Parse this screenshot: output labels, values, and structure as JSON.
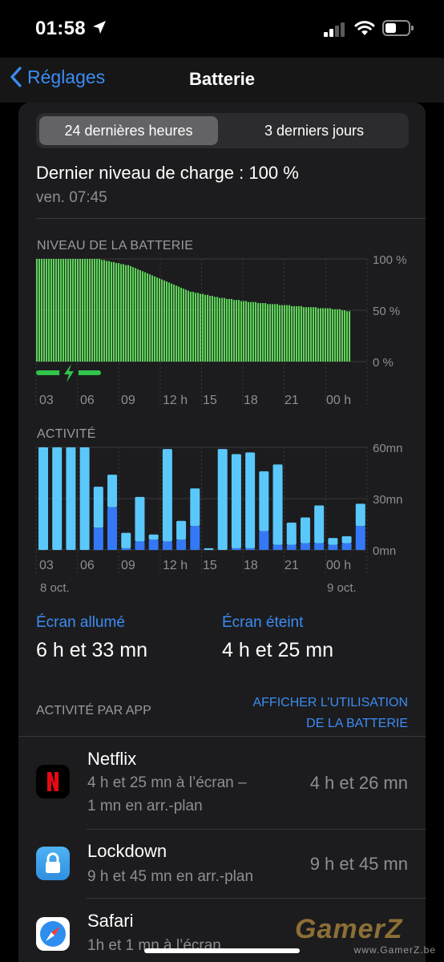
{
  "status": {
    "time": "01:58"
  },
  "nav": {
    "back_label": "Réglages",
    "title": "Batterie"
  },
  "segments": [
    "24 dernières heures",
    "3 derniers jours"
  ],
  "last_charge": {
    "label": "Dernier niveau de charge : 100 %",
    "date": "ven. 07:45"
  },
  "battery_chart": {
    "title": "NIVEAU DE LA BATTERIE",
    "y_ticks": [
      "100 %",
      "50 %",
      "0 %"
    ],
    "x_ticks": [
      "03",
      "06",
      "09",
      "12 h",
      "15",
      "18",
      "21",
      "00 h"
    ]
  },
  "activity_chart": {
    "title": "ACTIVITÉ",
    "y_ticks": [
      "60mn",
      "30mn",
      "0mn"
    ],
    "x_ticks": [
      "03",
      "06",
      "09",
      "12 h",
      "15",
      "18",
      "21",
      "00 h"
    ],
    "date_start": "8 oct.",
    "date_end": "9 oct."
  },
  "chart_data": [
    {
      "type": "area",
      "title": "NIVEAU DE LA BATTERIE",
      "unit": "%",
      "ylim": [
        0,
        100
      ],
      "categories": [
        "03",
        "06",
        "09",
        "12 h",
        "15",
        "18",
        "21",
        "00 h"
      ],
      "values": [
        100,
        100,
        100,
        100,
        100,
        100,
        100,
        100,
        100,
        100,
        100,
        100,
        100,
        100,
        100,
        100,
        100,
        100,
        100,
        100,
        100,
        100,
        100,
        100,
        100,
        100,
        100,
        99,
        99,
        98,
        98,
        97,
        97,
        96,
        96,
        95,
        95,
        94,
        94,
        93,
        92,
        91,
        90,
        89,
        88,
        87,
        86,
        85,
        84,
        83,
        82,
        81,
        80,
        79,
        78,
        77,
        76,
        75,
        74,
        73,
        72,
        71,
        70,
        69,
        68,
        68,
        67,
        67,
        66,
        66,
        65,
        65,
        64,
        64,
        63,
        63,
        62,
        62,
        62,
        61,
        61,
        61,
        60,
        60,
        60,
        59,
        59,
        59,
        58,
        58,
        58,
        58,
        57,
        57,
        57,
        57,
        56,
        56,
        56,
        56,
        56,
        55,
        55,
        55,
        55,
        55,
        54,
        54,
        54,
        54,
        54,
        53,
        53,
        53,
        53,
        53,
        53,
        52,
        52,
        52,
        52,
        52,
        52,
        51,
        51,
        51,
        51,
        50,
        50,
        49,
        49
      ],
      "charging_until_index": 26
    },
    {
      "type": "bar",
      "title": "ACTIVITÉ",
      "unit": "mn",
      "ylim": [
        0,
        60
      ],
      "x": [
        "01",
        "02",
        "03",
        "04",
        "05",
        "06",
        "07",
        "08",
        "09",
        "10",
        "11",
        "12",
        "13",
        "14",
        "15",
        "16",
        "17",
        "18",
        "19",
        "20",
        "21",
        "22",
        "23",
        "00"
      ],
      "series": [
        {
          "name": "Écran allumé",
          "values": [
            60,
            60,
            60,
            60,
            24,
            19,
            9,
            26,
            3,
            54,
            11,
            22,
            1,
            59,
            55,
            56,
            35,
            47,
            13,
            15,
            22,
            4,
            4,
            13
          ]
        },
        {
          "name": "Écran éteint",
          "values": [
            0,
            0,
            0,
            0,
            13,
            25,
            1,
            5,
            6,
            5,
            6,
            14,
            0,
            0,
            1,
            1,
            11,
            3,
            3,
            4,
            4,
            3,
            4,
            14
          ]
        }
      ],
      "colors": {
        "Écran allumé": "#5ac8fa",
        "Écran éteint": "#3478f6"
      }
    }
  ],
  "stats": [
    {
      "label": "Écran allumé",
      "value": "6 h et 33 mn"
    },
    {
      "label": "Écran éteint",
      "value": "4 h et 25 mn"
    }
  ],
  "app_section": {
    "title": "ACTIVITÉ PAR APP",
    "link_line1": "AFFICHER L’UTILISATION",
    "link_line2": "DE LA BATTERIE"
  },
  "apps": [
    {
      "name": "Netflix",
      "sub1": "4 h et 25 mn à l’écran –",
      "sub2": "1 mn en arr.-plan",
      "time": "4 h et 26 mn",
      "icon": "netflix-icon"
    },
    {
      "name": "Lockdown",
      "sub1": "9 h et 45 mn en arr.-plan",
      "sub2": "",
      "time": "9 h et 45 mn",
      "icon": "lock-icon"
    },
    {
      "name": "Safari",
      "sub1": "1h et 1 mn à l’écran",
      "sub2": "",
      "time": "",
      "icon": "compass-icon"
    }
  ],
  "watermark": {
    "text": "GamerZ",
    "sub": "www.GamerZ.be"
  },
  "colors": {
    "accent": "#3c8cf3",
    "battery_green": "#5fd35a",
    "charge_green": "#30c44b"
  }
}
